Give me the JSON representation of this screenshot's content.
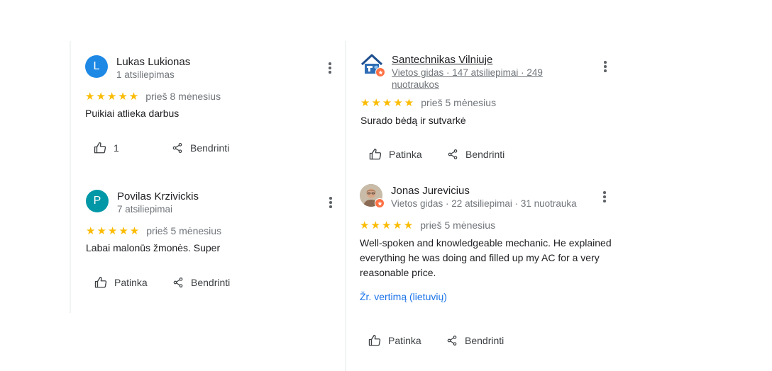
{
  "reviews": [
    {
      "author": "Lukas Lukionas",
      "avatar_letter": "L",
      "avatar_color": "#1e88e5",
      "meta": "1 atsiliepimas",
      "stars": 5,
      "stars_text": "★★★★★",
      "time": "prieš 8 mėnesius",
      "text": "Puikiai atlieka darbus",
      "like_label": "1",
      "share_label": "Bendrinti"
    },
    {
      "author": "Povilas Krzivickis",
      "avatar_letter": "P",
      "avatar_color": "#0097a7",
      "meta": "7 atsiliepimai",
      "stars": 5,
      "stars_text": "★★★★★",
      "time": "prieš 5 mėnesius",
      "text": "Labai malonūs žmonės. Super",
      "like_label": "Patinka",
      "share_label": "Bendrinti"
    },
    {
      "author": "Santechnikas Vilniuje",
      "avatar_icon": "house-logo-icon",
      "meta_line1": "Vietos gidas · 147 atsiliepimai · 249",
      "meta_line2": "nuotraukos",
      "stars": 5,
      "stars_text": "★★★★★",
      "time": "prieš 5 mėnesius",
      "text": "Surado bėdą ir sutvarkė",
      "like_label": "Patinka",
      "share_label": "Bendrinti"
    },
    {
      "author": "Jonas Jurevicius",
      "avatar_icon": "profile-photo",
      "meta": "Vietos gidas · 22 atsiliepimai · 31 nuotrauka",
      "stars": 5,
      "stars_text": "★★★★★",
      "time": "prieš 5 mėnesius",
      "text_lines": [
        "Well-spoken and knowledgeable mechanic. He explained",
        "everything he was doing and filled up my AC for a very",
        "reasonable price."
      ],
      "translate_label": "Žr. vertimą (lietuvių)",
      "like_label": "Patinka",
      "share_label": "Bendrinti"
    }
  ],
  "colors": {
    "star": "#fbbc04",
    "link": "#1a73e8",
    "local_guide_badge": "#ff7043"
  }
}
